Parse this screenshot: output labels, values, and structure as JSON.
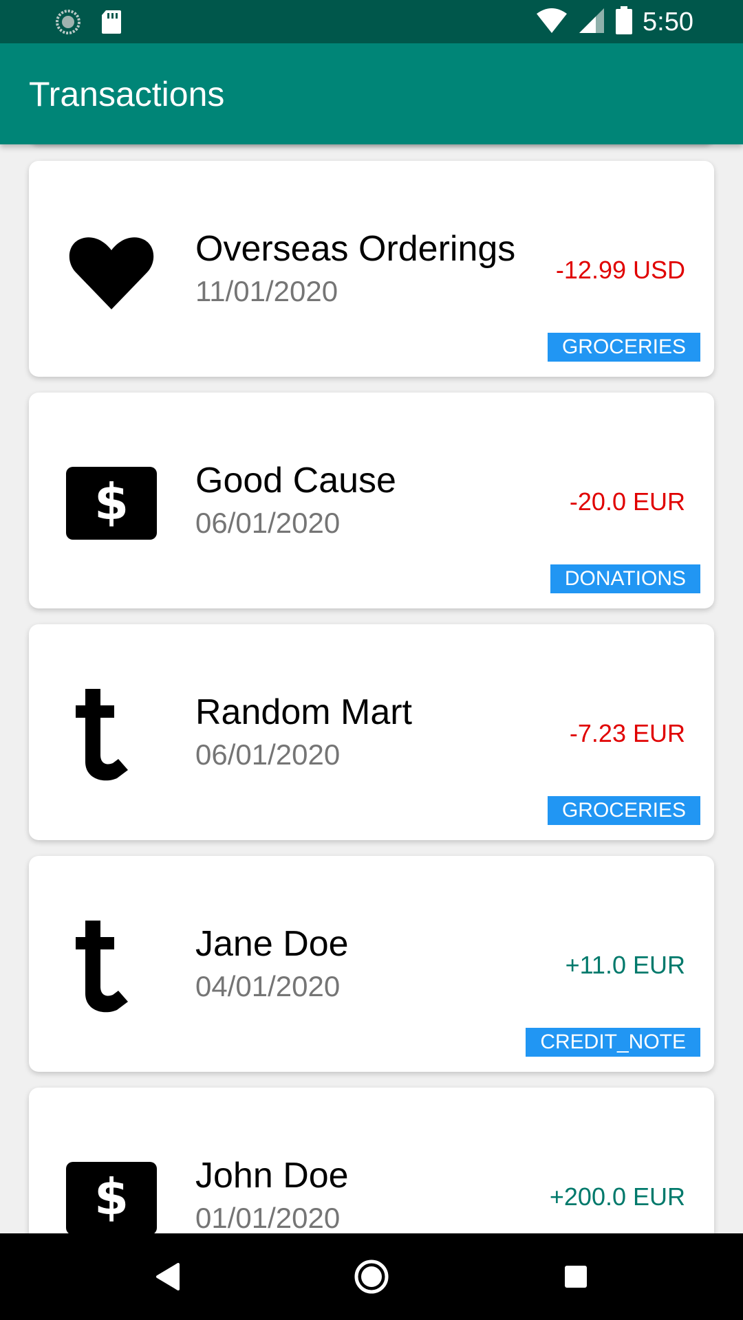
{
  "status_bar": {
    "time": "5:50",
    "icons": [
      "sync-icon",
      "sd-card-icon",
      "wifi-icon",
      "signal-icon",
      "battery-icon"
    ]
  },
  "app_bar": {
    "title": "Transactions",
    "color": "#008577"
  },
  "transactions": [
    {
      "icon": "heart-icon",
      "name": "Overseas Orderings",
      "date": "11/01/2020",
      "amount": "-12.99 USD",
      "type": "negative",
      "category": "GROCERIES"
    },
    {
      "icon": "dollar-icon",
      "name": "Good Cause",
      "date": "06/01/2020",
      "amount": "-20.0 EUR",
      "type": "negative",
      "category": "DONATIONS"
    },
    {
      "icon": "tumblr-icon",
      "name": "Random Mart",
      "date": "06/01/2020",
      "amount": "-7.23 EUR",
      "type": "negative",
      "category": "GROCERIES"
    },
    {
      "icon": "tumblr-icon",
      "name": "Jane Doe",
      "date": "04/01/2020",
      "amount": "+11.0 EUR",
      "type": "positive",
      "category": "CREDIT_NOTE"
    },
    {
      "icon": "dollar-icon",
      "name": "John Doe",
      "date": "01/01/2020",
      "amount": "+200.0 EUR",
      "type": "positive",
      "category": ""
    }
  ],
  "colors": {
    "negative": "#e00000",
    "positive": "#00796b",
    "tag": "#2196f3"
  },
  "nav_bar": {
    "buttons": [
      "back-icon",
      "home-icon",
      "recents-icon"
    ]
  }
}
